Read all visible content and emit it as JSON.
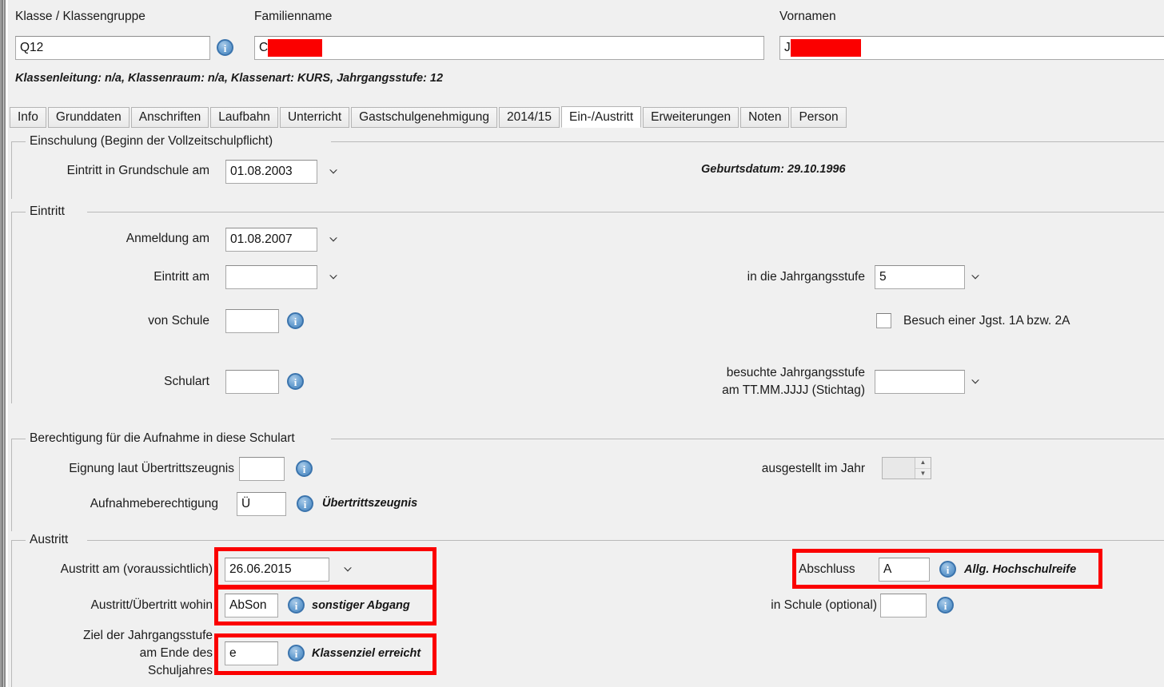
{
  "header": {
    "class_label": "Klasse / Klassengruppe",
    "class_value": "Q12",
    "lastname_label": "Familienname",
    "lastname_value": "C",
    "firstname_label": "Vornamen",
    "firstname_value": "J",
    "class_info_line": "Klassenleitung: n/a, Klassenraum: n/a, Klassenart: KURS, Jahrgangsstufe: 12"
  },
  "tabs": [
    {
      "label": "Info",
      "active": false
    },
    {
      "label": "Grunddaten",
      "active": false
    },
    {
      "label": "Anschriften",
      "active": false
    },
    {
      "label": "Laufbahn",
      "active": false
    },
    {
      "label": "Unterricht",
      "active": false
    },
    {
      "label": "Gastschulgenehmigung",
      "active": false
    },
    {
      "label": "2014/15",
      "active": false
    },
    {
      "label": "Ein-/Austritt",
      "active": true
    },
    {
      "label": "Erweiterungen",
      "active": false
    },
    {
      "label": "Noten",
      "active": false
    },
    {
      "label": "Person",
      "active": false
    }
  ],
  "einschulung": {
    "legend": "Einschulung (Beginn der Vollzeitschulpflicht)",
    "grundschule_label": "Eintritt in Grundschule am",
    "grundschule_value": "01.08.2003",
    "geburtsdatum": "Geburtsdatum: 29.10.1996"
  },
  "eintritt": {
    "legend": "Eintritt",
    "anmeldung_label": "Anmeldung am",
    "anmeldung_value": "01.08.2007",
    "eintritt_label": "Eintritt am",
    "eintritt_value": "",
    "von_schule_label": "von Schule",
    "von_schule_value": "",
    "schulart_label": "Schulart",
    "schulart_value": "",
    "jahrgangsstufe_label": "in die Jahrgangsstufe",
    "jahrgangsstufe_value": "5",
    "besuch_checkbox_label": "Besuch einer Jgst. 1A bzw. 2A",
    "besuchte_label_line1": "besuchte Jahrgangsstufe",
    "besuchte_label_line2": "am TT.MM.JJJJ (Stichtag)",
    "besuchte_value": ""
  },
  "berechtigung": {
    "legend": "Berechtigung für die Aufnahme in diese Schulart",
    "eignung_label": "Eignung laut Übertrittszeugnis",
    "eignung_value": "",
    "aufnahme_label": "Aufnahmeberechtigung",
    "aufnahme_value": "Ü",
    "aufnahme_hint": "Übertrittszeugnis",
    "jahr_label": "ausgestellt im Jahr",
    "jahr_value": ""
  },
  "austritt": {
    "legend": "Austritt",
    "austritt_am_label": "Austritt am (voraussichtlich)",
    "austritt_am_value": "26.06.2015",
    "wohin_label": "Austritt/Übertritt wohin",
    "wohin_value": "AbSon",
    "wohin_hint": "sonstiger Abgang",
    "ziel_label_line1": "Ziel der Jahrgangsstufe",
    "ziel_label_line2": "am Ende des",
    "ziel_label_line3": "Schuljahres",
    "ziel_value": "e",
    "ziel_hint": "Klassenziel erreicht",
    "abschluss_label": "Abschluss",
    "abschluss_value": "A",
    "abschluss_hint": "Allg. Hochschulreife",
    "in_schule_label": "in Schule (optional)",
    "in_schule_value": ""
  },
  "colors": {
    "window_bg": "#f0f0f0",
    "field_bg": "#ffffff",
    "border": "#a8a8a8",
    "annotation_red": "#fb0000",
    "info_icon_blue": "#4b86bd",
    "text": "#1b1b1b"
  }
}
